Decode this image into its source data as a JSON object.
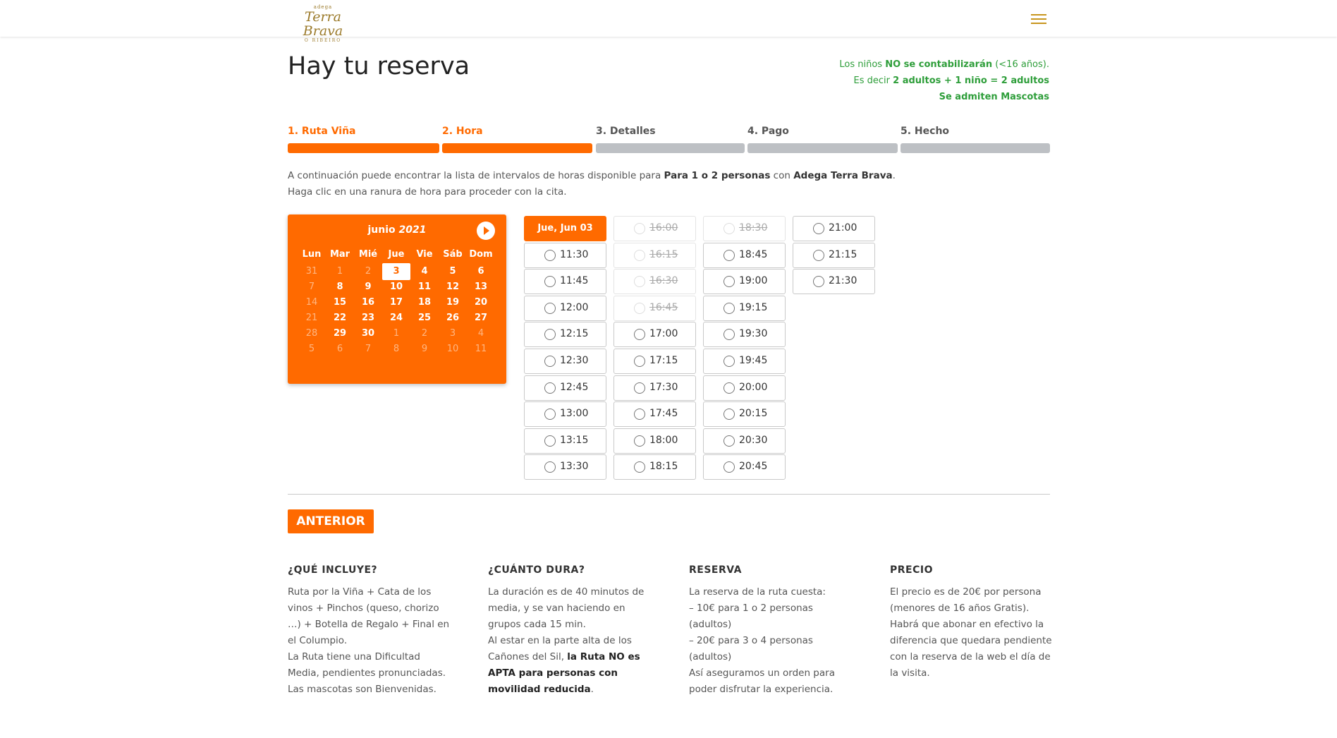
{
  "header": {
    "logo_small": "adega",
    "logo_main": "Terra Brava",
    "logo_sub": "O RIBEIRO"
  },
  "page": {
    "title": "Hay tu reserva"
  },
  "notice": {
    "line1_pre": "Los niños ",
    "line1_bold": "NO se contabilizarán",
    "line1_post": " (<16 años).",
    "line2_pre": "Es decir ",
    "line2_bold": "2 adultos + 1 niño = 2 adultos",
    "line3_bold": "Se admiten Mascotas"
  },
  "steps": [
    {
      "label": "1. Ruta Viña",
      "state": "done"
    },
    {
      "label": "2. Hora",
      "state": "done"
    },
    {
      "label": "3. Detalles",
      "state": "todo"
    },
    {
      "label": "4. Pago",
      "state": "todo"
    },
    {
      "label": "5. Hecho",
      "state": "todo"
    }
  ],
  "intro": {
    "l1_pre": "A continuación puede encontrar la lista de intervalos de horas disponible para ",
    "l1_bold1": "Para 1 o 2 personas",
    "l1_mid": " con ",
    "l1_bold2": "Adega Terra Brava",
    "l1_post": ".",
    "l2": "Haga clic en una ranura de hora para proceder con la cita."
  },
  "calendar": {
    "month": "junio",
    "year": "2021",
    "weekdays": [
      "Lun",
      "Mar",
      "Mié",
      "Jue",
      "Vie",
      "Sáb",
      "Dom"
    ],
    "weeks": [
      [
        {
          "d": "31",
          "s": "off"
        },
        {
          "d": "1",
          "s": "off"
        },
        {
          "d": "2",
          "s": "off"
        },
        {
          "d": "3",
          "s": "sel"
        },
        {
          "d": "4",
          "s": "on"
        },
        {
          "d": "5",
          "s": "on"
        },
        {
          "d": "6",
          "s": "on"
        }
      ],
      [
        {
          "d": "7",
          "s": "off"
        },
        {
          "d": "8",
          "s": "on"
        },
        {
          "d": "9",
          "s": "on"
        },
        {
          "d": "10",
          "s": "on"
        },
        {
          "d": "11",
          "s": "on"
        },
        {
          "d": "12",
          "s": "on"
        },
        {
          "d": "13",
          "s": "on"
        }
      ],
      [
        {
          "d": "14",
          "s": "off"
        },
        {
          "d": "15",
          "s": "on"
        },
        {
          "d": "16",
          "s": "on"
        },
        {
          "d": "17",
          "s": "on"
        },
        {
          "d": "18",
          "s": "on"
        },
        {
          "d": "19",
          "s": "on"
        },
        {
          "d": "20",
          "s": "on"
        }
      ],
      [
        {
          "d": "21",
          "s": "off"
        },
        {
          "d": "22",
          "s": "on"
        },
        {
          "d": "23",
          "s": "on"
        },
        {
          "d": "24",
          "s": "on"
        },
        {
          "d": "25",
          "s": "on"
        },
        {
          "d": "26",
          "s": "on"
        },
        {
          "d": "27",
          "s": "on"
        }
      ],
      [
        {
          "d": "28",
          "s": "off"
        },
        {
          "d": "29",
          "s": "on"
        },
        {
          "d": "30",
          "s": "on"
        },
        {
          "d": "1",
          "s": "off"
        },
        {
          "d": "2",
          "s": "off"
        },
        {
          "d": "3",
          "s": "off"
        },
        {
          "d": "4",
          "s": "off"
        }
      ],
      [
        {
          "d": "5",
          "s": "off"
        },
        {
          "d": "6",
          "s": "off"
        },
        {
          "d": "7",
          "s": "off"
        },
        {
          "d": "8",
          "s": "off"
        },
        {
          "d": "9",
          "s": "off"
        },
        {
          "d": "10",
          "s": "off"
        },
        {
          "d": "11",
          "s": "off"
        }
      ]
    ]
  },
  "slots": {
    "date_header": "Jue, Jun 03",
    "columns": [
      [
        {
          "t": "11:30",
          "a": true
        },
        {
          "t": "11:45",
          "a": true
        },
        {
          "t": "12:00",
          "a": true
        },
        {
          "t": "12:15",
          "a": true
        },
        {
          "t": "12:30",
          "a": true
        },
        {
          "t": "12:45",
          "a": true
        },
        {
          "t": "13:00",
          "a": true
        },
        {
          "t": "13:15",
          "a": true
        },
        {
          "t": "13:30",
          "a": true
        }
      ],
      [
        {
          "t": "16:00",
          "a": false
        },
        {
          "t": "16:15",
          "a": false
        },
        {
          "t": "16:30",
          "a": false
        },
        {
          "t": "16:45",
          "a": false
        },
        {
          "t": "17:00",
          "a": true
        },
        {
          "t": "17:15",
          "a": true
        },
        {
          "t": "17:30",
          "a": true
        },
        {
          "t": "17:45",
          "a": true
        },
        {
          "t": "18:00",
          "a": true
        },
        {
          "t": "18:15",
          "a": true
        }
      ],
      [
        {
          "t": "18:30",
          "a": false
        },
        {
          "t": "18:45",
          "a": true
        },
        {
          "t": "19:00",
          "a": true
        },
        {
          "t": "19:15",
          "a": true
        },
        {
          "t": "19:30",
          "a": true
        },
        {
          "t": "19:45",
          "a": true
        },
        {
          "t": "20:00",
          "a": true
        },
        {
          "t": "20:15",
          "a": true
        },
        {
          "t": "20:30",
          "a": true
        },
        {
          "t": "20:45",
          "a": true
        }
      ],
      [
        {
          "t": "21:00",
          "a": true
        },
        {
          "t": "21:15",
          "a": true
        },
        {
          "t": "21:30",
          "a": true
        }
      ]
    ]
  },
  "buttons": {
    "prev": "ANTERIOR"
  },
  "info": {
    "incluye": {
      "title": "¿QUÉ INCLUYE?",
      "lines": [
        "Ruta por la Viña + Cata de los",
        "vinos + Pinchos (queso, chorizo",
        "…) + Botella de Regalo + Final en",
        "el Columpio.",
        "La Ruta tiene una Dificultad",
        "Media, pendientes pronunciadas.",
        "Las mascotas son Bienvenidas."
      ]
    },
    "dura": {
      "title": "¿CUÁNTO DURA?",
      "l1": "La duración es de 40 minutos de",
      "l2": "media, y se van haciendo en",
      "l3": "grupos cada 15 min.",
      "l4": "Al estar en la parte alta de los",
      "l5_pre": "Cañones del Sil, ",
      "l5_bold": "la Ruta NO es",
      "l6_bold": "APTA para personas con",
      "l7_bold": "movilidad reducida",
      "l7_post": "."
    },
    "reserva": {
      "title": "RESERVA",
      "lines": [
        "La reserva de la ruta cuesta:",
        "– 10€ para 1 o 2 personas",
        "(adultos)",
        "– 20€ para 3 o 4 personas",
        "(adultos)",
        "Así aseguramos un orden para",
        "poder disfrutar la experiencia."
      ]
    },
    "precio": {
      "title": "PRECIO",
      "lines": [
        "El precio es de 20€  por persona",
        "(menores de 16 años Gratis).",
        "Habrá que abonar en efectivo la",
        "diferencia que quedara pendiente",
        "con la reserva de la web el día de",
        "la visita."
      ]
    }
  },
  "colors": {
    "accent": "#ff6a00",
    "notice_green": "#2e9e3a",
    "logo_gold": "#9b7a2a"
  }
}
